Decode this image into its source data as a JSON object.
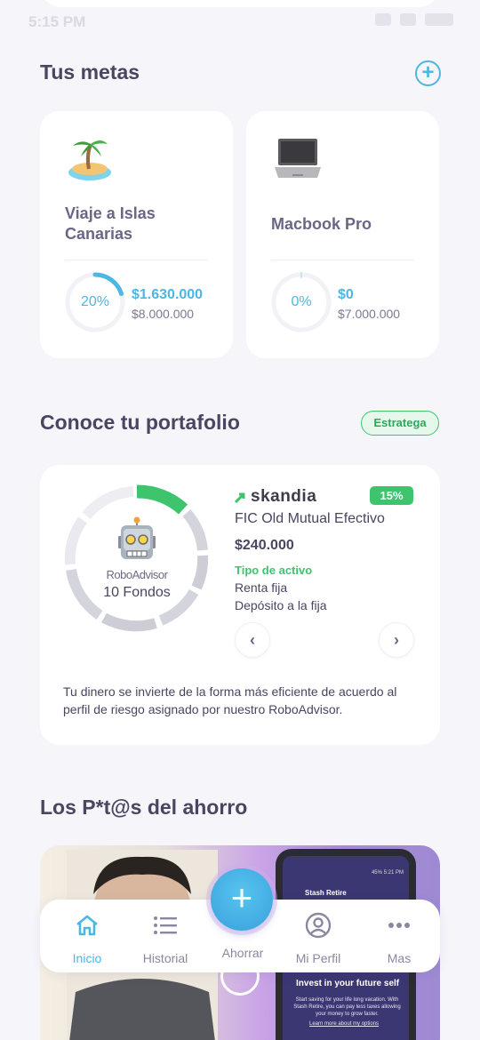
{
  "status_bar": {
    "time": "5:15 PM"
  },
  "goals": {
    "title": "Tus metas",
    "items": [
      {
        "name": "Viaje a Islas Canarias",
        "icon": "island-icon",
        "percent": "20%",
        "progress": 0.2,
        "saved": "$1.630.000",
        "target": "$8.000.000"
      },
      {
        "name": "Macbook Pro",
        "icon": "laptop-icon",
        "percent": "0%",
        "progress": 0,
        "saved": "$0",
        "target": "$7.000.000"
      }
    ]
  },
  "portfolio": {
    "title": "Conoce tu portafolio",
    "strategy_label": "Estratega",
    "robo_label": "RoboAdvisor",
    "fund_count": "10 Fondos",
    "brand": "skandia",
    "return_badge": "15%",
    "fund_name": "FIC Old Mutual Efectivo",
    "amount": "$240.000",
    "asset_type_label": "Tipo de activo",
    "asset_lines": [
      "Renta fija",
      "Depósito a la fija"
    ],
    "description": "Tu dinero se invierte de la forma más eficiente de acuerdo al perfil de riesgo asignado por nuestro RoboAdvisor.",
    "accent_color": "#3ec46d"
  },
  "tips": {
    "title": "Los P*t@s del ahorro",
    "phone": {
      "status": "45% 5:21 PM",
      "title": "Stash Retire",
      "headline": "Invest in your future self",
      "body": "Start saving for your life long vacation. With Stash Retire, you can pay less taxes allowing your money to grow faster.",
      "link": "Learn more about my options"
    }
  },
  "bottom_nav": {
    "items": [
      "Inicio",
      "Historial",
      "Ahorrar",
      "Mi Perfil",
      "Mas"
    ],
    "active": "Inicio"
  },
  "colors": {
    "accent": "#4cb7e3",
    "green": "#3ec46d",
    "text": "#4a4560"
  }
}
